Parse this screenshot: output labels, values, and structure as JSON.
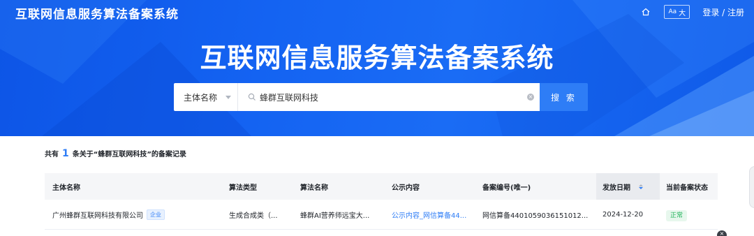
{
  "header": {
    "site_title": "互联网信息服务算法备案系统",
    "font_toggle_small": "Aa",
    "font_toggle_big": "大",
    "login_label": "登录 / 注册",
    "banner_title": "互联网信息服务算法备案系统"
  },
  "search": {
    "type_label": "主体名称",
    "value": "蜂群互联网科技",
    "button_label": "搜 索"
  },
  "summary": {
    "prefix": "共有",
    "count": "1",
    "suffix": "条关于“蜂群互联网科技”的备案记录"
  },
  "table": {
    "columns": [
      "主体名称",
      "算法类型",
      "算法名称",
      "公示内容",
      "备案编号(唯一)",
      "发放日期",
      "当前备案状态"
    ],
    "rows": [
      {
        "entity": "广州蜂群互联网科技有限公司",
        "entity_tag": "企业",
        "algo_type": "生成合成类（...",
        "algo_name": "蜂群AI营养师远宝大...",
        "disclosure": "公示内容_网信算备44...",
        "record_no": "网信算备4401059036151012...",
        "issue_date": "2024-12-20",
        "status": "正常"
      }
    ]
  },
  "colors": {
    "brand_blue": "#1463f2",
    "accent": "#2e7df6",
    "status_green": "#21b35a"
  },
  "icons": [
    "home-icon",
    "search-icon",
    "clear-icon",
    "caret-down-icon",
    "sort-icon"
  ]
}
